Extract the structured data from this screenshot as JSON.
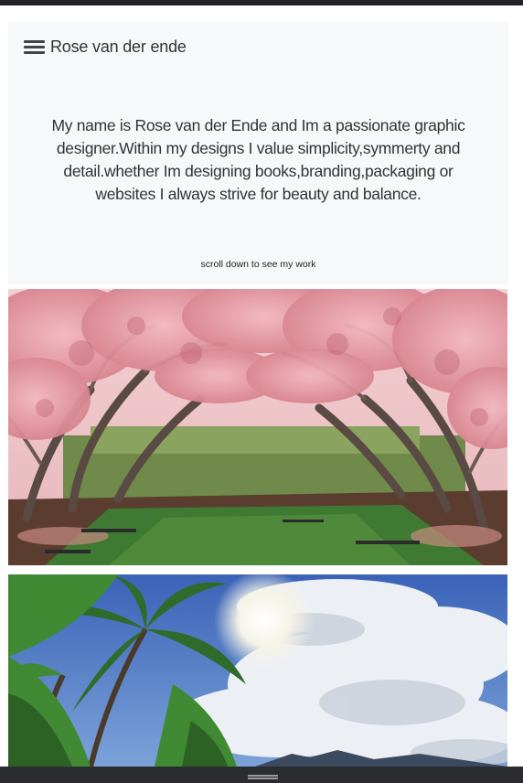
{
  "header": {
    "site_name": "Rose van der ende",
    "menu_icon": "hamburger-menu-icon"
  },
  "intro": {
    "text": "My name is Rose van der Ende and Im a passionate graphic designer.Within my designs I value simplicity,symmerty and detail.whether Im designing books,branding,packaging or websites I always strive for beauty and balance.",
    "scroll_hint": "scroll down to see my work"
  },
  "gallery": [
    {
      "subject": "blossoming magnolia tree alley"
    },
    {
      "subject": "palm trees under cloudy blue sky"
    }
  ],
  "colors": {
    "header_background": "#f7f8fa",
    "text": "#333333",
    "bars": "#222326"
  }
}
